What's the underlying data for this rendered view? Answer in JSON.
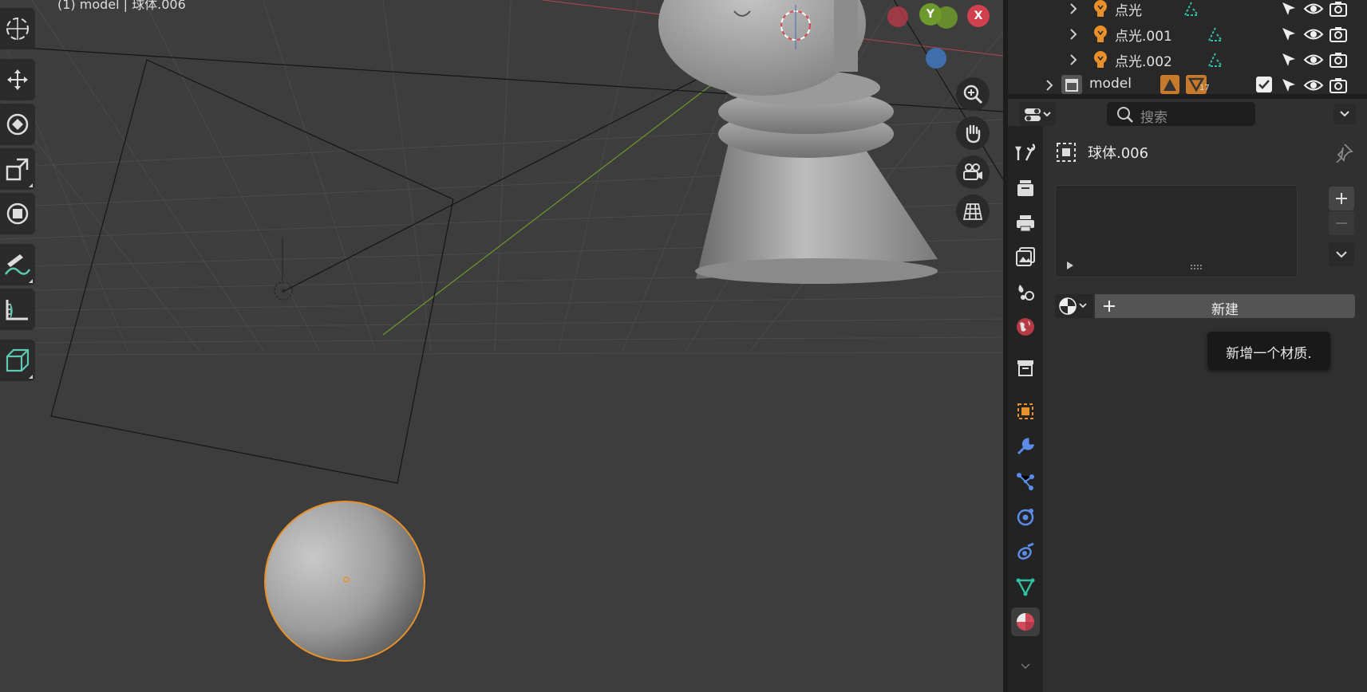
{
  "viewport": {
    "header_text": "(1) model | 球体.006",
    "gizmo": {
      "x_label": "X",
      "y_label": "Y"
    }
  },
  "toolbar": {
    "tools": [
      "cursor",
      "move",
      "rotate",
      "scale",
      "transform",
      "annotate",
      "measure",
      "add-cube"
    ]
  },
  "nav_buttons": [
    "zoom",
    "pan",
    "camera",
    "ortho-grid"
  ],
  "outliner": {
    "rows": [
      {
        "label": "点光",
        "type": "light"
      },
      {
        "label": "点光.001",
        "type": "light"
      },
      {
        "label": "点光.002",
        "type": "light"
      },
      {
        "label": "model",
        "type": "collection",
        "badge": "17"
      }
    ]
  },
  "properties": {
    "search_placeholder": "搜索",
    "object_name": "球体.006",
    "new_button_label": "新建",
    "tooltip": "新增一个材质.",
    "tabs": [
      "tool",
      "render",
      "output",
      "view-layer",
      "scene",
      "world",
      "collection",
      "object",
      "modifiers",
      "particles",
      "physics",
      "constraints",
      "data",
      "material"
    ],
    "active_tab": "material"
  },
  "colors": {
    "accent_orange": "#e8912a",
    "axis_red": "#c94b56",
    "axis_green": "#6d9a2c",
    "axis_blue": "#3f6eaa",
    "tab_blue": "#5b8de8"
  }
}
